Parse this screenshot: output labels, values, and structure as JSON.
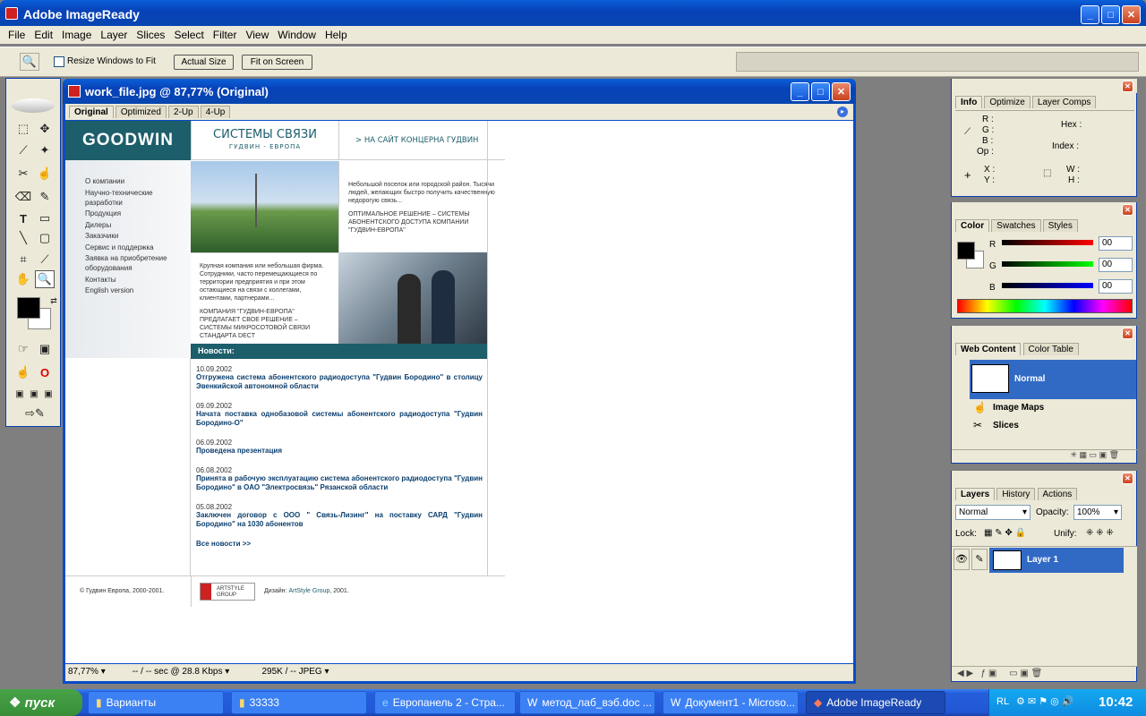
{
  "app": {
    "title": "Adobe ImageReady"
  },
  "menu": [
    "File",
    "Edit",
    "Image",
    "Layer",
    "Slices",
    "Select",
    "Filter",
    "View",
    "Window",
    "Help"
  ],
  "options": {
    "resize_label": "Resize Windows to Fit",
    "actual_size": "Actual Size",
    "fit_on_screen": "Fit on Screen"
  },
  "doc": {
    "title": "work_file.jpg @ 87,77% (Original)",
    "tabs": [
      "Original",
      "Optimized",
      "2-Up",
      "4-Up"
    ],
    "status": {
      "zoom": "87,77%",
      "speed": "-- / -- sec @ 28.8 Kbps",
      "size": "295K / -- JPEG"
    }
  },
  "site": {
    "logo": "GOODWIN",
    "header_title": "СИСТЕМЫ СВЯЗИ",
    "header_sub": "ГУДВИН - ЕВРОПА",
    "link_concern": "НА САЙТ КОНЦЕРНА ГУДВИН",
    "nav": [
      "О компании",
      "Научно-технические разработки",
      "Продукция",
      "Дилеры",
      "Заказчики",
      "Сервис и поддержка",
      "Заявка на приобретение оборудования",
      "Контакты",
      "English version"
    ],
    "block1_text": "Небольшой поселок или городской район. Тысячи людей, желающих быстро получить качественную недорогую связь...",
    "block1_solution": "ОПТИМАЛЬНОЕ РЕШЕНИЕ – СИСТЕМЫ АБОНЕНТСКОГО ДОСТУПА КОМПАНИИ \"ГУДВИН-ЕВРОПА\"",
    "block2_text": "Крупная компания или небольшая фирма. Сотрудники, часто перемещающиеся по территории предприятия и при этом остающиеся на связи с коллегами, клиентами, партнерами...",
    "block2_solution": "КОМПАНИЯ \"ГУДВИН-ЕВРОПА\" ПРЕДЛАГАЕТ СВОЕ РЕШЕНИЕ – СИСТЕМЫ МИКРОСОТОВОЙ СВЯЗИ СТАНДАРТА DECT",
    "news_header": "Новости:",
    "news": [
      {
        "date": "10.09.2002",
        "text": "Отгружена система абонентского радиодоступа \"Гудвин Бородино\" в столицу Эвенкийской автономной области"
      },
      {
        "date": "09.09.2002",
        "text": "Начата поставка однобазовой системы абонентского радиодоступа \"Гудвин Бородино-О\""
      },
      {
        "date": "06.09.2002",
        "text": "Проведена презентация"
      },
      {
        "date": "06.08.2002",
        "text": "Принята в рабочую эксплуатацию система абонентского радиодоступа \"Гудвин Бородино\" в ОАО \"Электросвязь\" Рязанской области"
      },
      {
        "date": "05.08.2002",
        "text": "Заключен договор с ООО \" Связь-Лизинг\" на поставку САРД \"Гудвин Бородино\" на 1030 абонентов"
      }
    ],
    "all_news": "Все новости >>",
    "copyright": "© Гудвин Европа, 2000-2001.",
    "artstyle_logo": "ARTSTYLE GROUP",
    "design_prefix": "Дизайн:",
    "design_link": "ArtStyle Group",
    "design_suffix": ", 2001."
  },
  "info_panel": {
    "tabs": [
      "Info",
      "Optimize",
      "Layer Comps"
    ],
    "labels": [
      "R :",
      "G :",
      "B :",
      "Op :",
      "Hex :",
      "Index :",
      "X :",
      "Y :",
      "W :",
      "H :"
    ]
  },
  "color_panel": {
    "tabs": [
      "Color",
      "Swatches",
      "Styles"
    ],
    "channels": [
      {
        "name": "R",
        "value": "00"
      },
      {
        "name": "G",
        "value": "00"
      },
      {
        "name": "B",
        "value": "00"
      }
    ]
  },
  "web_panel": {
    "tabs": [
      "Web Content",
      "Color Table"
    ],
    "items": [
      "Normal",
      "Image Maps",
      "Slices"
    ]
  },
  "layers_panel": {
    "tabs": [
      "Layers",
      "History",
      "Actions"
    ],
    "blend_mode": "Normal",
    "opacity_label": "Opacity:",
    "opacity": "100%",
    "lock_label": "Lock:",
    "unify_label": "Unify:",
    "layers": [
      {
        "name": "Layer 1"
      }
    ]
  },
  "taskbar": {
    "start": "пуск",
    "items": [
      "Варианты",
      "33333",
      "Европанель 2 - Стра...",
      "метод_лаб_вэб.doc ...",
      "Документ1 - Microso...",
      "Adobe ImageReady"
    ],
    "lang": "RL",
    "clock": "10:42"
  },
  "colors": {
    "xp_blue": "#0746b0",
    "site_teal": "#1d5e6b",
    "selected": "#316ac5"
  }
}
